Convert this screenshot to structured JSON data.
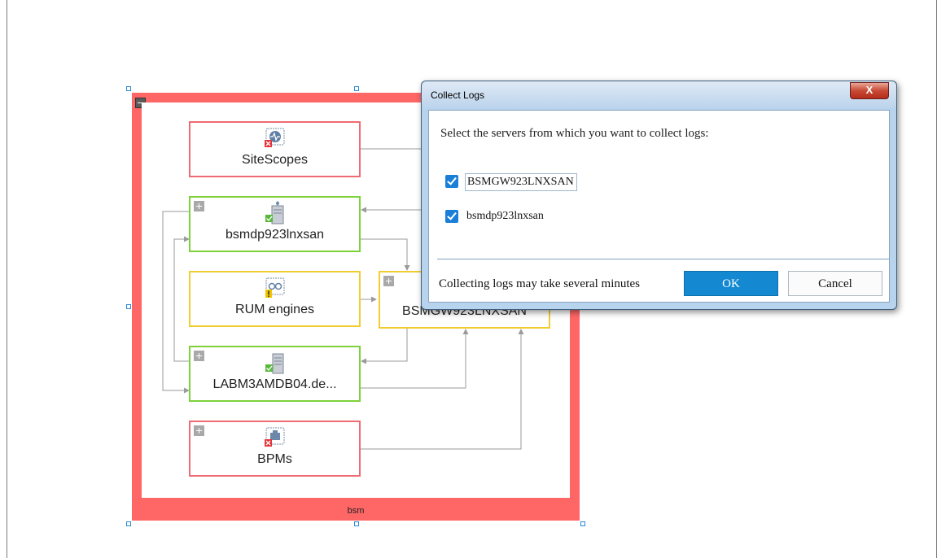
{
  "canvas": {
    "group": {
      "label": "bsm",
      "accent": "#ff6666"
    },
    "nodes": [
      {
        "label": "SiteScopes",
        "border": "red",
        "icon": "sitescope-monitor-icon",
        "status": "error-x-icon",
        "expandable": false
      },
      {
        "label": "bsmdp923lnxsan",
        "border": "green",
        "icon": "server-tower-icon",
        "status": "ok-check-icon",
        "expandable": true
      },
      {
        "label": "RUM engines",
        "border": "yellow",
        "icon": "rum-engine-icon",
        "status": "warning-exclamation-icon",
        "expandable": false
      },
      {
        "label": "BSMGW923LNXSAN",
        "border": "yellow",
        "icon": "server-icon",
        "status": "",
        "expandable": true
      },
      {
        "label": "LABM3AMDB04.de...",
        "border": "green",
        "icon": "database-server-icon",
        "status": "ok-check-icon",
        "expandable": true
      },
      {
        "label": "BPMs",
        "border": "red",
        "icon": "bpm-agent-icon",
        "status": "error-x-icon",
        "expandable": true
      }
    ],
    "colors": {
      "red": "#ee6b72",
      "green": "#7dd13a",
      "yellow": "#f1cd32",
      "connector": "#9a9a9a"
    }
  },
  "dialog": {
    "title": "Collect Logs",
    "close_label": "X",
    "prompt": "Select the servers from which you want to collect logs:",
    "servers": [
      {
        "name": "BSMGW923LNXSAN",
        "checked": true
      },
      {
        "name": "bsmdp923lnxsan",
        "checked": true
      }
    ],
    "footer_note": "Collecting logs may take several minutes",
    "ok_label": "OK",
    "cancel_label": "Cancel",
    "accent": "#1489d2"
  }
}
